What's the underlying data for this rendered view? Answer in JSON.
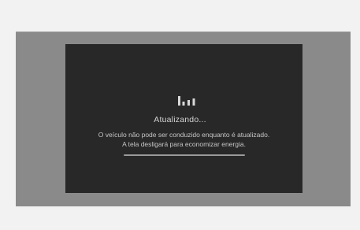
{
  "dialog": {
    "icon": "update-bars-icon",
    "title": "Atualizando...",
    "message_line1": "O veículo não pode ser conduzido enquanto é atualizado.",
    "message_line2": "A tela desligará para economizar energia.",
    "progress": 1.0
  },
  "colors": {
    "page_bg": "#f2f2f2",
    "frame": "#8a8a8a",
    "screen": "#282828",
    "text": "#d2d2d2",
    "progress_fill": "#9b9b9b"
  }
}
